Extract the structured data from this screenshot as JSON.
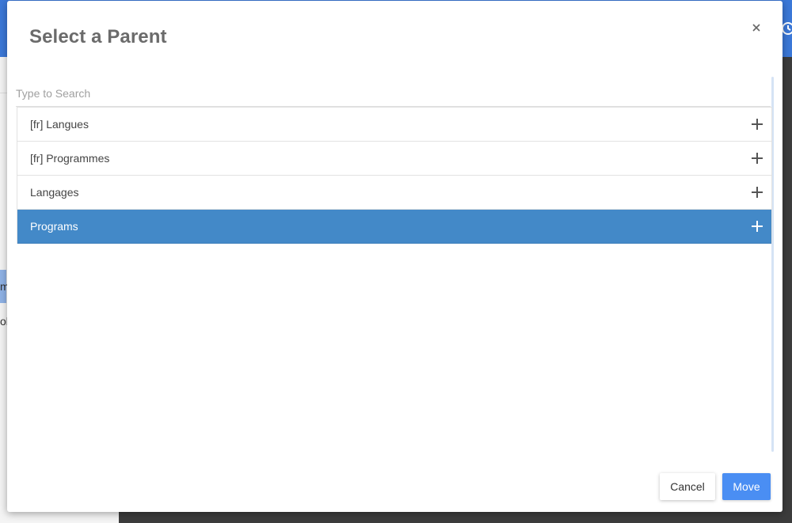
{
  "background": {
    "left_fragments": [
      "m",
      "ol"
    ]
  },
  "modal": {
    "title": "Select a Parent",
    "close_icon": "close-icon",
    "search": {
      "placeholder": "Type to Search",
      "value": ""
    },
    "options": [
      {
        "label": "[fr] Langues",
        "selected": false,
        "icon": "plus-icon"
      },
      {
        "label": "[fr] Programmes",
        "selected": false,
        "icon": "plus-icon"
      },
      {
        "label": "Langages",
        "selected": false,
        "icon": "plus-icon"
      },
      {
        "label": "Programs",
        "selected": true,
        "icon": "plus-icon"
      }
    ],
    "cancel_label": "Cancel",
    "move_label": "Move"
  },
  "colors": {
    "accent": "#4a8ef3",
    "selected_row": "#4389c8",
    "topbar": "#3b78d8"
  }
}
